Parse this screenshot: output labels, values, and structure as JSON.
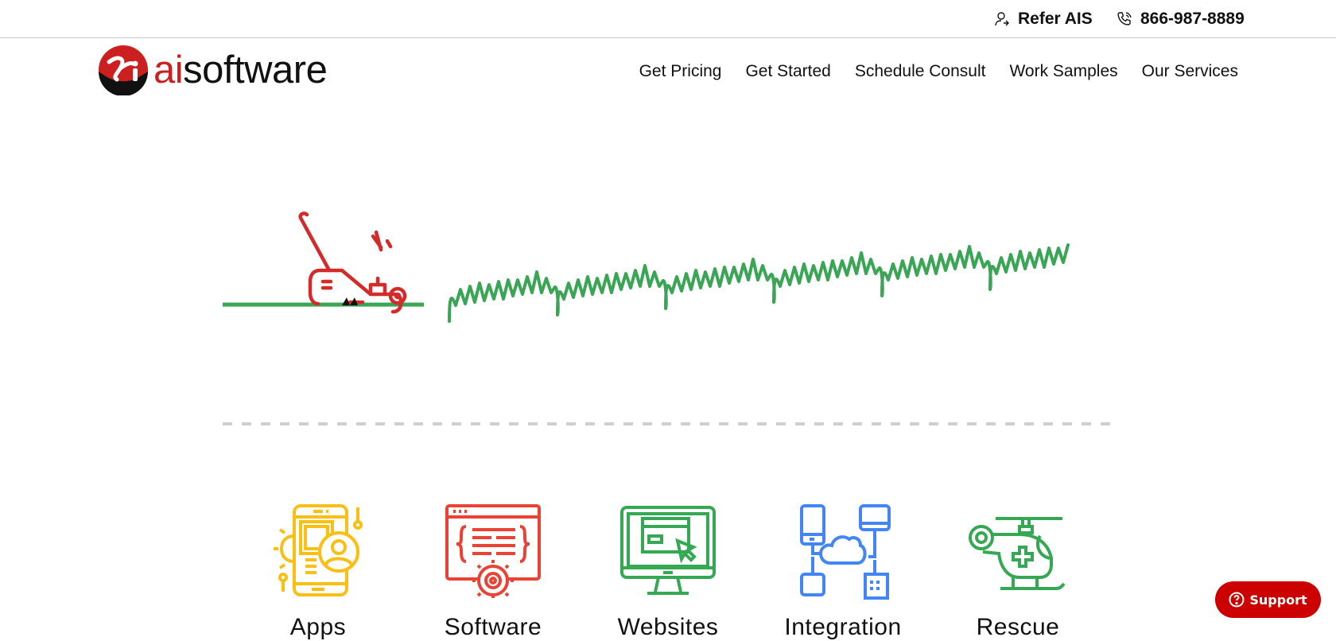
{
  "topbar": {
    "refer_label": "Refer AIS",
    "phone_label": "866-987-8889",
    "refer_icon": "user-refer-icon",
    "phone_icon": "phone-icon"
  },
  "logo": {
    "ai": "ai",
    "software": "software",
    "brand_color": "#cc1f1f"
  },
  "nav": {
    "items": [
      {
        "label": "Get Pricing"
      },
      {
        "label": "Get Started"
      },
      {
        "label": "Schedule Consult"
      },
      {
        "label": "Work Samples"
      },
      {
        "label": "Our Services"
      }
    ]
  },
  "hero": {
    "mower_color": "#d42a2a",
    "grass_color": "#3aa655"
  },
  "services": [
    {
      "label": "Apps",
      "icon": "mobile-app-icon",
      "color": "#f9bf15"
    },
    {
      "label": "Software",
      "icon": "software-code-icon",
      "color": "#ea4335"
    },
    {
      "label": "Websites",
      "icon": "website-monitor-icon",
      "color": "#34a853"
    },
    {
      "label": "Integration",
      "icon": "cloud-integration-icon",
      "color": "#4285f4"
    },
    {
      "label": "Rescue",
      "icon": "rescue-helicopter-icon",
      "color": "#34a853"
    }
  ],
  "support": {
    "label": "Support",
    "color": "#cc0000"
  }
}
